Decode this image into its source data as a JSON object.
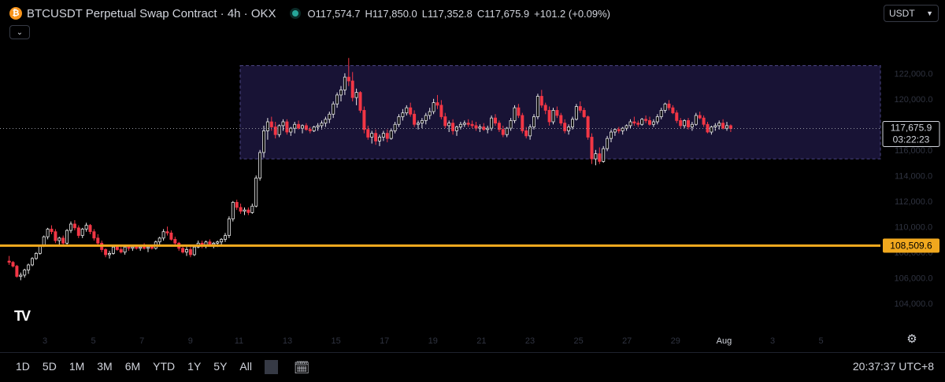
{
  "header": {
    "symbol_icon": "btc-coin-icon",
    "title": "BTCUSDT Perpetual Swap Contract · 4h · OKX",
    "ohlc": {
      "open_label": "O",
      "open": "117,574.7",
      "high_label": "H",
      "high": "117,850.0",
      "low_label": "L",
      "low": "117,352.8",
      "close_label": "C",
      "close": "117,675.9",
      "change": "+101.2 (+0.09%)"
    }
  },
  "currency_select": {
    "value": "USDT"
  },
  "logo": "TV",
  "toolbar": {
    "ranges": [
      "1D",
      "5D",
      "1M",
      "3M",
      "6M",
      "YTD",
      "1Y",
      "5Y",
      "All"
    ],
    "compare_icon": "calendar-range-icon",
    "clock": "20:37:37 UTC+8"
  },
  "colors": {
    "up": "#e8e8e8",
    "down": "#f23645",
    "support_line": "#f0a81e",
    "range_fill": "#181335",
    "range_border": "#4a4483",
    "text": "#d1d4dc"
  },
  "chart_data": {
    "type": "candlestick",
    "interval": "4h",
    "ylim": [
      103000,
      127000
    ],
    "y_ticks": [
      104000,
      106000,
      108000,
      110000,
      112000,
      114000,
      116000,
      118000,
      120000,
      122000
    ],
    "y_tick_labels": [
      "104,000.0",
      "106,000.0",
      "108,000.0",
      "110,000.0",
      "112,000.0",
      "114,000.0",
      "116,000.0",
      "118,000.0",
      "120,000.0",
      "122,000.0"
    ],
    "x_tick_labels": [
      "3",
      "5",
      "7",
      "9",
      "11",
      "13",
      "15",
      "17",
      "19",
      "21",
      "23",
      "25",
      "27",
      "29",
      "Aug",
      "3",
      "5"
    ],
    "current_price": "117,675.9",
    "countdown": "03:22:23",
    "support_level": {
      "value": 108509.6,
      "label": "108,509.6"
    },
    "range_box": {
      "top": 122600,
      "bottom": 115300
    },
    "candles": [
      [
        107300,
        107700,
        107000,
        107200
      ],
      [
        107200,
        107300,
        106800,
        106900
      ],
      [
        106900,
        107000,
        106000,
        106100
      ],
      [
        106100,
        106400,
        105800,
        106200
      ],
      [
        106200,
        106700,
        106000,
        106600
      ],
      [
        106600,
        107100,
        106300,
        107000
      ],
      [
        107000,
        107600,
        106900,
        107500
      ],
      [
        107500,
        108000,
        107400,
        107900
      ],
      [
        107900,
        108600,
        107800,
        108500
      ],
      [
        108500,
        109300,
        108400,
        109200
      ],
      [
        109200,
        109900,
        109000,
        109800
      ],
      [
        109800,
        110100,
        109400,
        109600
      ],
      [
        109600,
        109800,
        108700,
        108900
      ],
      [
        108900,
        109200,
        108600,
        109100
      ],
      [
        109100,
        109300,
        108500,
        108700
      ],
      [
        108700,
        109800,
        108600,
        109700
      ],
      [
        109700,
        110400,
        109500,
        110200
      ],
      [
        110200,
        110500,
        109700,
        109900
      ],
      [
        109900,
        110100,
        109100,
        109300
      ],
      [
        109300,
        109900,
        109100,
        109800
      ],
      [
        109800,
        110300,
        109600,
        110100
      ],
      [
        110100,
        110200,
        109400,
        109600
      ],
      [
        109600,
        109800,
        108900,
        109100
      ],
      [
        109100,
        109400,
        108500,
        108700
      ],
      [
        108700,
        108900,
        108000,
        108200
      ],
      [
        108200,
        108300,
        107600,
        107800
      ],
      [
        107800,
        108100,
        107500,
        107900
      ],
      [
        107900,
        108500,
        107800,
        108400
      ],
      [
        108400,
        108600,
        108100,
        108200
      ],
      [
        108200,
        108400,
        107900,
        108000
      ],
      [
        108000,
        108500,
        107800,
        108400
      ],
      [
        108400,
        108500,
        108100,
        108300
      ],
      [
        108300,
        108500,
        108100,
        108400
      ],
      [
        108400,
        108600,
        108200,
        108300
      ],
      [
        108300,
        108500,
        108100,
        108400
      ],
      [
        108400,
        108700,
        108200,
        108300
      ],
      [
        108300,
        108500,
        108000,
        108400
      ],
      [
        108400,
        108600,
        108200,
        108300
      ],
      [
        108300,
        108900,
        108200,
        108800
      ],
      [
        108800,
        109200,
        108600,
        109100
      ],
      [
        109100,
        109800,
        108900,
        109600
      ],
      [
        109600,
        110000,
        109300,
        109500
      ],
      [
        109500,
        109700,
        108900,
        109000
      ],
      [
        109000,
        109200,
        108500,
        108700
      ],
      [
        108700,
        108800,
        108100,
        108300
      ],
      [
        108300,
        108500,
        107900,
        108000
      ],
      [
        108000,
        108400,
        107700,
        108200
      ],
      [
        108200,
        108500,
        107600,
        107800
      ],
      [
        107800,
        108500,
        107700,
        108400
      ],
      [
        108400,
        108900,
        108300,
        108700
      ],
      [
        108700,
        108900,
        108300,
        108500
      ],
      [
        108500,
        108900,
        108300,
        108800
      ],
      [
        108800,
        109000,
        108500,
        108600
      ],
      [
        108600,
        108800,
        108300,
        108700
      ],
      [
        108700,
        108900,
        108400,
        108800
      ],
      [
        108800,
        109100,
        108500,
        109000
      ],
      [
        109000,
        109500,
        108800,
        109300
      ],
      [
        109300,
        110800,
        109100,
        110600
      ],
      [
        110600,
        112000,
        110400,
        111900
      ],
      [
        111900,
        112100,
        111300,
        111500
      ],
      [
        111500,
        111800,
        111000,
        111200
      ],
      [
        111200,
        111500,
        110900,
        111300
      ],
      [
        111300,
        111500,
        110900,
        111100
      ],
      [
        111100,
        111800,
        111000,
        111600
      ],
      [
        111600,
        114000,
        111500,
        113800
      ],
      [
        113800,
        116000,
        113600,
        115800
      ],
      [
        115800,
        117900,
        115400,
        117500
      ],
      [
        117500,
        118500,
        116800,
        118200
      ],
      [
        118200,
        118600,
        117500,
        117800
      ],
      [
        117800,
        118200,
        116900,
        117200
      ],
      [
        117200,
        118000,
        117000,
        117900
      ],
      [
        117900,
        118400,
        117500,
        118200
      ],
      [
        118200,
        118400,
        117200,
        117400
      ],
      [
        117400,
        117800,
        117100,
        117700
      ],
      [
        117700,
        118200,
        117300,
        118000
      ],
      [
        118000,
        118300,
        117600,
        117700
      ],
      [
        117700,
        118000,
        117300,
        117900
      ],
      [
        117900,
        118100,
        117500,
        117600
      ],
      [
        117600,
        117800,
        117300,
        117500
      ],
      [
        117500,
        117900,
        117400,
        117800
      ],
      [
        117800,
        118100,
        117500,
        117900
      ],
      [
        117900,
        118300,
        117600,
        118100
      ],
      [
        118100,
        118600,
        117800,
        118400
      ],
      [
        118400,
        119000,
        118100,
        118800
      ],
      [
        118800,
        119800,
        118500,
        119600
      ],
      [
        119600,
        120500,
        119300,
        120300
      ],
      [
        120300,
        121000,
        119800,
        120700
      ],
      [
        120700,
        122000,
        120300,
        121700
      ],
      [
        121700,
        123200,
        121000,
        121400
      ],
      [
        121400,
        122100,
        119800,
        120100
      ],
      [
        120100,
        120800,
        119500,
        120500
      ],
      [
        120500,
        120600,
        118900,
        119100
      ],
      [
        119100,
        119400,
        117300,
        117600
      ],
      [
        117600,
        117900,
        116800,
        117000
      ],
      [
        117000,
        117500,
        116500,
        117300
      ],
      [
        117300,
        117600,
        116400,
        116700
      ],
      [
        116700,
        117200,
        116300,
        117000
      ],
      [
        117000,
        117500,
        116700,
        117300
      ],
      [
        117300,
        117600,
        116600,
        116900
      ],
      [
        116900,
        117700,
        116800,
        117500
      ],
      [
        117500,
        118200,
        117300,
        118000
      ],
      [
        118000,
        118800,
        117800,
        118600
      ],
      [
        118600,
        119200,
        118300,
        118900
      ],
      [
        118900,
        119500,
        118700,
        119300
      ],
      [
        119300,
        119700,
        118600,
        118800
      ],
      [
        118800,
        119100,
        117800,
        118000
      ],
      [
        118000,
        118300,
        117600,
        118100
      ],
      [
        118100,
        118500,
        117700,
        118300
      ],
      [
        118300,
        118900,
        118000,
        118700
      ],
      [
        118700,
        119300,
        118400,
        119000
      ],
      [
        119000,
        120000,
        118800,
        119700
      ],
      [
        119700,
        120300,
        119200,
        119500
      ],
      [
        119500,
        119900,
        118400,
        118600
      ],
      [
        118600,
        118900,
        117700,
        117900
      ],
      [
        117900,
        118300,
        117400,
        118100
      ],
      [
        118100,
        118400,
        117200,
        117500
      ],
      [
        117500,
        117900,
        117100,
        117800
      ],
      [
        117800,
        118200,
        117600,
        118000
      ],
      [
        118000,
        118300,
        117800,
        118100
      ],
      [
        118100,
        118400,
        117800,
        118000
      ],
      [
        118000,
        118300,
        117700,
        117900
      ],
      [
        117900,
        118200,
        117500,
        117700
      ],
      [
        117700,
        118000,
        117400,
        117800
      ],
      [
        117800,
        118100,
        117500,
        117600
      ],
      [
        117600,
        117900,
        117300,
        117700
      ],
      [
        117700,
        118700,
        117500,
        118500
      ],
      [
        118500,
        118800,
        117900,
        118100
      ],
      [
        118100,
        118300,
        117400,
        117600
      ],
      [
        117600,
        117900,
        117000,
        117200
      ],
      [
        117200,
        117800,
        117000,
        117700
      ],
      [
        117700,
        118500,
        117500,
        118300
      ],
      [
        118300,
        119500,
        118100,
        119300
      ],
      [
        119300,
        119600,
        118500,
        118700
      ],
      [
        118700,
        118900,
        117300,
        117500
      ],
      [
        117500,
        117800,
        116900,
        117100
      ],
      [
        117100,
        118000,
        116800,
        117800
      ],
      [
        117800,
        118800,
        117600,
        118600
      ],
      [
        118600,
        120400,
        118400,
        120200
      ],
      [
        120200,
        120700,
        119300,
        119500
      ],
      [
        119500,
        119700,
        118800,
        119100
      ],
      [
        119100,
        119400,
        117900,
        118200
      ],
      [
        118200,
        119300,
        118000,
        119100
      ],
      [
        119100,
        119400,
        118500,
        118700
      ],
      [
        118700,
        118900,
        117900,
        118100
      ],
      [
        118100,
        118400,
        117300,
        117500
      ],
      [
        117500,
        118000,
        117200,
        117800
      ],
      [
        117800,
        118600,
        117600,
        118400
      ],
      [
        118400,
        119600,
        118300,
        119400
      ],
      [
        119400,
        119800,
        118900,
        119100
      ],
      [
        119100,
        119300,
        118500,
        118600
      ],
      [
        118600,
        118700,
        116800,
        117000
      ],
      [
        117000,
        117300,
        114900,
        115300
      ],
      [
        115300,
        116000,
        114800,
        115700
      ],
      [
        115700,
        116200,
        114900,
        115100
      ],
      [
        115100,
        116300,
        115000,
        116100
      ],
      [
        116100,
        117100,
        115900,
        116900
      ],
      [
        116900,
        117600,
        116600,
        117400
      ],
      [
        117400,
        117700,
        117100,
        117600
      ],
      [
        117600,
        117800,
        117300,
        117500
      ],
      [
        117500,
        117800,
        117200,
        117700
      ],
      [
        117700,
        118000,
        117500,
        117900
      ],
      [
        117900,
        118400,
        117700,
        118200
      ],
      [
        118200,
        118600,
        117900,
        118100
      ],
      [
        118100,
        118300,
        117800,
        118000
      ],
      [
        118000,
        118500,
        117900,
        118400
      ],
      [
        118400,
        118700,
        118100,
        118300
      ],
      [
        118300,
        118600,
        117900,
        118000
      ],
      [
        118000,
        118400,
        117800,
        118200
      ],
      [
        118200,
        118800,
        118000,
        118600
      ],
      [
        118600,
        119300,
        118400,
        119100
      ],
      [
        119100,
        119700,
        118900,
        119600
      ],
      [
        119600,
        119900,
        119100,
        119300
      ],
      [
        119300,
        119500,
        118800,
        118900
      ],
      [
        118900,
        119100,
        118100,
        118300
      ],
      [
        118300,
        118500,
        117700,
        117900
      ],
      [
        117900,
        118400,
        117700,
        118300
      ],
      [
        118300,
        118500,
        117600,
        117800
      ],
      [
        117800,
        118200,
        117500,
        118000
      ],
      [
        118000,
        118900,
        117900,
        118700
      ],
      [
        118700,
        119000,
        118400,
        118500
      ],
      [
        118500,
        118700,
        117800,
        118000
      ],
      [
        118000,
        118200,
        117300,
        117400
      ],
      [
        117400,
        117900,
        117200,
        117800
      ],
      [
        117800,
        118100,
        117500,
        117900
      ],
      [
        117900,
        118300,
        117600,
        118100
      ],
      [
        118100,
        118400,
        117600,
        117700
      ],
      [
        117700,
        118200,
        117500,
        117900
      ],
      [
        117900,
        118000,
        117400,
        117676
      ]
    ]
  }
}
